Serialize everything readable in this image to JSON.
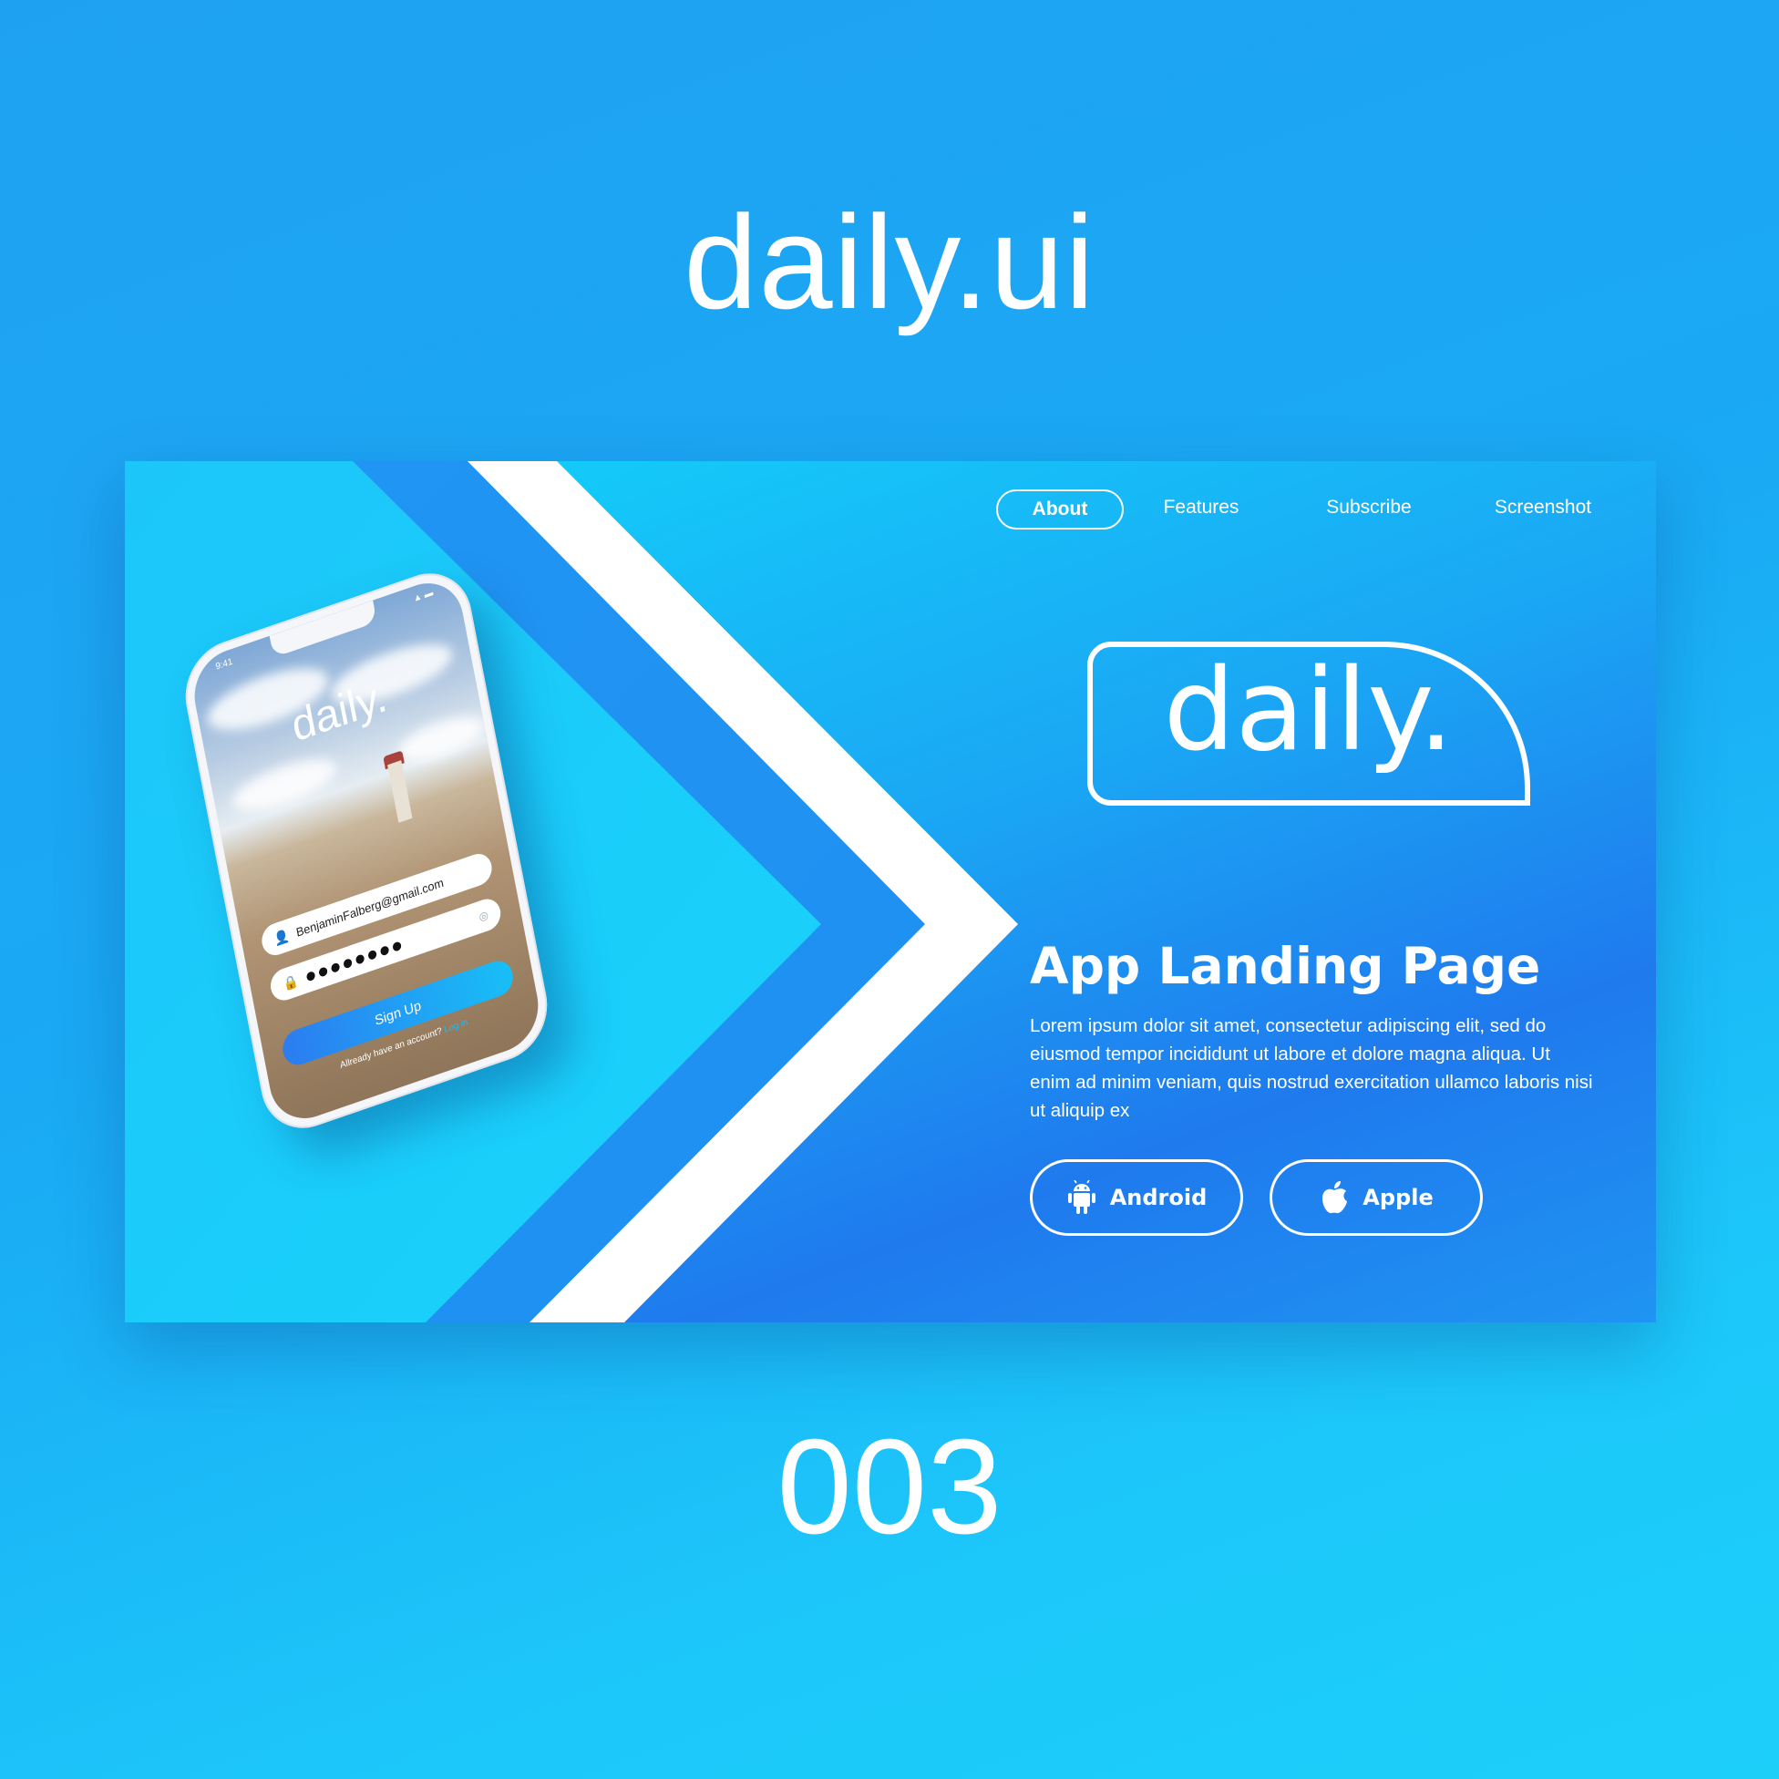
{
  "outer": {
    "title": "daily.ui",
    "number": "003"
  },
  "nav": {
    "items": [
      {
        "label": "About",
        "active": true
      },
      {
        "label": "Features",
        "active": false
      },
      {
        "label": "Subscribe",
        "active": false
      },
      {
        "label": "Screenshot",
        "active": false
      }
    ]
  },
  "logo": {
    "text": "daily."
  },
  "hero": {
    "headline": "App Landing Page",
    "description": "Lorem ipsum dolor sit amet, consectetur adipiscing elit, sed do eiusmod tempor incididunt ut labore et dolore magna aliqua. Ut enim ad minim veniam, quis nostrud exercitation ullamco laboris nisi ut aliquip ex"
  },
  "buttons": {
    "android": {
      "label": "Android",
      "icon": "android-icon"
    },
    "apple": {
      "label": "Apple",
      "icon": "apple-icon"
    }
  },
  "phone": {
    "status_time": "9:41",
    "app_name": "daily.",
    "email_value": "BenjaminFalberg@gmail.com",
    "password_mask": "●●●●●●●●",
    "signup_label": "Sign Up",
    "already_text": "Allready have an account?",
    "login_label": "Log in"
  },
  "colors": {
    "background_top": "#1fa1f2",
    "background_bottom": "#1ccff9",
    "card_light": "#12d5fb",
    "card_dark": "#1f7aee",
    "accent": "#18bff7"
  }
}
